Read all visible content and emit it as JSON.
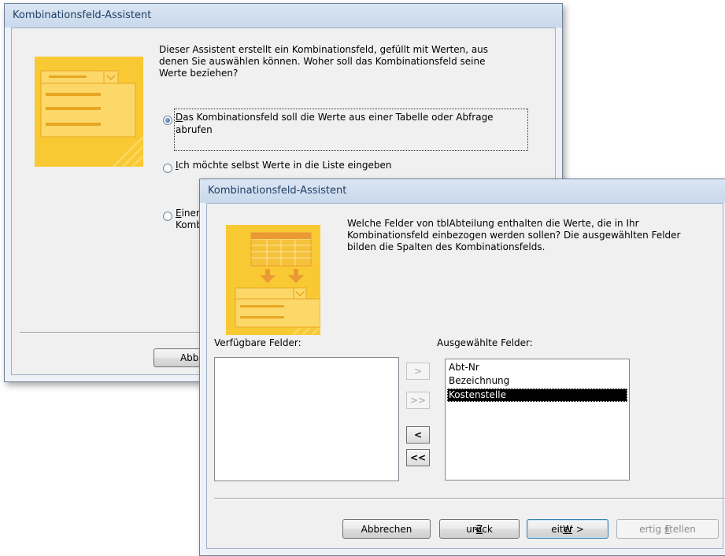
{
  "back_dialog": {
    "title": "Kombinationsfeld-Assistent",
    "intro": "Dieser Assistent erstellt ein Kombinationsfeld, gefüllt mit Werten, aus\ndenen Sie auswählen können. Woher soll das Kombinationsfeld seine\nWerte beziehen?",
    "option1_line1_rest": "as Kombinationsfeld soll die Werte aus einer Tabelle oder Abfrage",
    "option1_line1_key": "D",
    "option1_line2": "abrufen",
    "option2_key": "I",
    "option2_rest": "ch möchte selbst Werte in die Liste eingeben",
    "option3_line1_key": "E",
    "option3_line1_rest": "inen",
    "option3_line2": "Komb",
    "cancel_partial": "Abbrec"
  },
  "front_dialog": {
    "title": "Kombinationsfeld-Assistent",
    "intro": "Welche Felder von tblAbteilung enthalten die Werte, die in Ihr\nKombinationsfeld einbezogen werden sollen? Die ausgewählten Felder\nbilden die Spalten des Kombinationsfelds.",
    "available_label": "Verfügbare Felder:",
    "selected_label": "Ausgewählte Felder:",
    "selected_fields": [
      "Abt-Nr",
      "Bezeichnung",
      "Kostenstelle"
    ],
    "move_one_right": ">",
    "move_all_right": ">>",
    "move_one_left": "<",
    "move_all_left": "<<",
    "cancel_label": "Abbrechen",
    "back_prefix": "< ",
    "back_key": "Z",
    "back_rest": "urück",
    "next_key": "W",
    "next_rest": "eiter >",
    "finish_key": "F",
    "finish_rest": "ertig stellen"
  },
  "colors": {
    "accent_yellow": "#f9c933",
    "title_text": "#1f3f66"
  }
}
